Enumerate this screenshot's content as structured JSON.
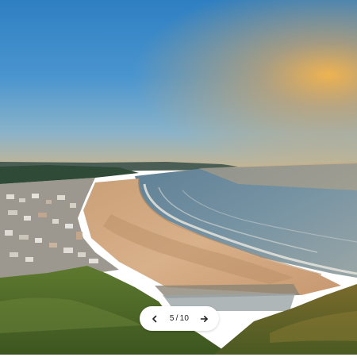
{
  "gallery": {
    "image_subject": "coastal-town-beach-sunset-photo",
    "pager": {
      "current": "5",
      "separator": "/",
      "total": "10",
      "prev_icon": "chevron-left-icon",
      "next_icon": "arrow-right-icon"
    }
  },
  "colors": {
    "pager_background": "#ffffff",
    "pager_text": "#222222"
  }
}
